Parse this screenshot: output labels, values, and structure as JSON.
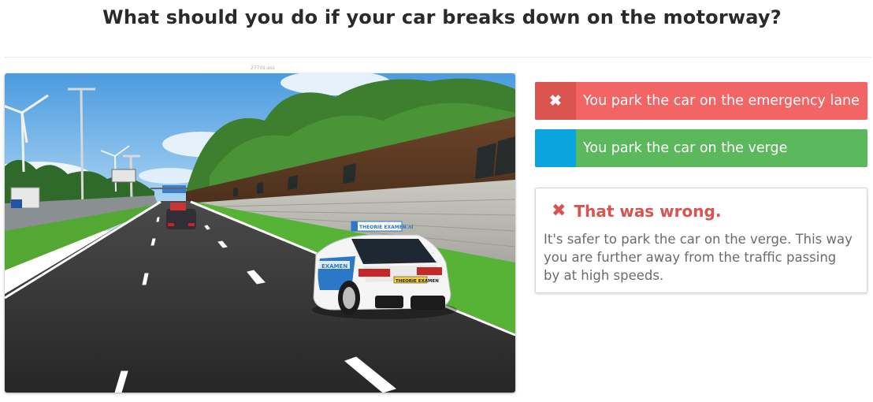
{
  "question": {
    "title": "What should you do if your car breaks down on the motorway?",
    "image_id": "27701.ass"
  },
  "scene": {
    "car_plate": "THEORIE EXAMEN",
    "roof_sign": "THEORIE EXAMEN.nl",
    "side_text": "EXAMEN"
  },
  "answers": [
    {
      "label": "You park the car on the emergency lane",
      "marker": "✖",
      "state": "wrong-selected",
      "color": "#f26564",
      "marker_color": "#d9534f"
    },
    {
      "label": "You park the car on the verge",
      "marker": "",
      "state": "correct",
      "color": "#5cb85c",
      "marker_color": "#0aa5e0"
    }
  ],
  "feedback": {
    "icon": "✖",
    "title": "That was wrong.",
    "text": "It's safer to park the car on the verge. This way you are further away from the traffic passing by at high speeds.",
    "color": "#d9534f"
  }
}
